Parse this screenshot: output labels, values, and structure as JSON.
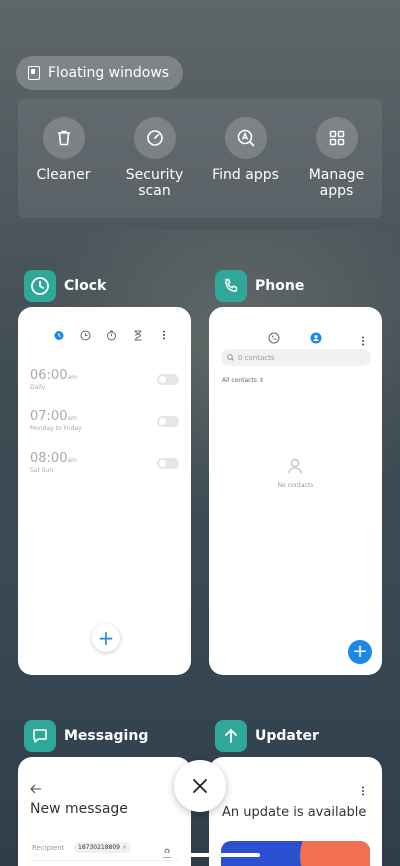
{
  "floating_windows": {
    "label": "Floating windows"
  },
  "tools": [
    {
      "label": "Cleaner",
      "icon": "trash-icon"
    },
    {
      "label": "Security\nscan",
      "icon": "security-scan-icon"
    },
    {
      "label": "Find apps",
      "icon": "find-apps-icon"
    },
    {
      "label": "Manage\napps",
      "icon": "manage-apps-icon"
    }
  ],
  "cards": {
    "clock": {
      "name": "Clock",
      "alarms": [
        {
          "time": "06:00",
          "suffix": "am",
          "days": "Daily"
        },
        {
          "time": "07:00",
          "suffix": "am",
          "days": "Monday to Friday"
        },
        {
          "time": "08:00",
          "suffix": "am",
          "days": "Sat Sun"
        }
      ]
    },
    "phone": {
      "name": "Phone",
      "search_placeholder": "0 contacts",
      "filter": "All contacts",
      "empty": "No contacts"
    },
    "messaging": {
      "name": "Messaging",
      "title": "New message",
      "recipient_label": "Recipient",
      "recipient_value": "18730218809"
    },
    "updater": {
      "name": "Updater",
      "title": "An update is available"
    }
  },
  "colors": {
    "accent_teal": "#2fa89a",
    "accent_blue": "#1e88e5"
  }
}
